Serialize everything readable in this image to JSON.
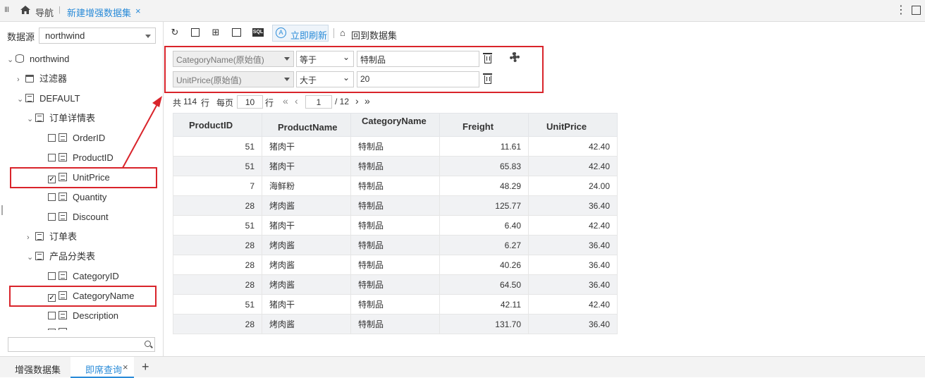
{
  "topbar": {
    "menu_icon": "menu-icon",
    "nav_label": "导航",
    "tab_label": "新建增强数据集",
    "close_symbol": "×",
    "more_symbol": "⋮"
  },
  "left": {
    "datasource_label": "数据源",
    "datasource_value": "northwind",
    "tree": {
      "root": "northwind",
      "filters": "过滤器",
      "default": "DEFAULT",
      "order_details": "订单详情表",
      "order_details_fields": [
        "OrderID",
        "ProductID",
        "UnitPrice",
        "Quantity",
        "Discount"
      ],
      "orders": "订单表",
      "categories": "产品分类表",
      "categories_fields": [
        "CategoryID",
        "CategoryName",
        "Description"
      ],
      "checked": [
        "UnitPrice",
        "CategoryName"
      ]
    },
    "search_placeholder": ""
  },
  "toolbar": {
    "refresh_now": "立即刷新",
    "back_to_dataset": "回到数据集",
    "sql_label": "SQL"
  },
  "filters": [
    {
      "field": "CategoryName(原始值)",
      "operator": "等于",
      "value": "特制品"
    },
    {
      "field": "UnitPrice(原始值)",
      "operator": "大于",
      "value": "20"
    }
  ],
  "paging": {
    "total_prefix": "共",
    "total": "114",
    "total_suffix": "行",
    "per_page_label": "每页",
    "per_page": "10",
    "per_page_suffix": "行",
    "current_page": "1",
    "total_pages": "/ 12"
  },
  "table": {
    "columns": [
      "ProductID",
      "ProductName",
      "CategoryName",
      "Freight",
      "UnitPrice"
    ],
    "rows": [
      [
        "51",
        "猪肉干",
        "特制品",
        "11.61",
        "42.40"
      ],
      [
        "51",
        "猪肉干",
        "特制品",
        "65.83",
        "42.40"
      ],
      [
        "7",
        "海鲜粉",
        "特制品",
        "48.29",
        "24.00"
      ],
      [
        "28",
        "烤肉酱",
        "特制品",
        "125.77",
        "36.40"
      ],
      [
        "51",
        "猪肉干",
        "特制品",
        "6.40",
        "42.40"
      ],
      [
        "28",
        "烤肉酱",
        "特制品",
        "6.27",
        "36.40"
      ],
      [
        "28",
        "烤肉酱",
        "特制品",
        "40.26",
        "36.40"
      ],
      [
        "28",
        "烤肉酱",
        "特制品",
        "64.50",
        "36.40"
      ],
      [
        "51",
        "猪肉干",
        "特制品",
        "42.11",
        "42.40"
      ],
      [
        "28",
        "烤肉酱",
        "特制品",
        "131.70",
        "36.40"
      ]
    ]
  },
  "bottom_tabs": {
    "tab1": "增强数据集",
    "tab2": "即席查询",
    "close_symbol": "×",
    "add_symbol": "+"
  },
  "colors": {
    "accent": "#2a8bd8",
    "highlight": "#d9242b"
  }
}
